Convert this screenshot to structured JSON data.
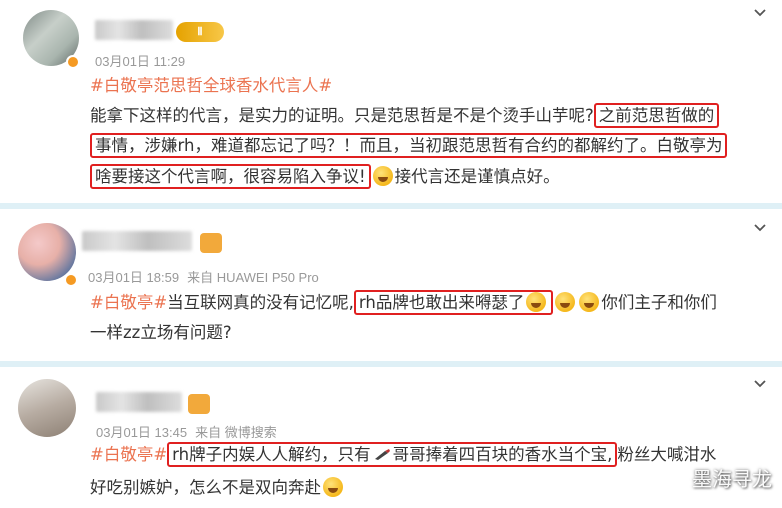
{
  "posts": [
    {
      "time": "03月01日 11:29",
      "source": "",
      "line1_pre": "能拿下这样的代言，是实力的证明。只是范思哲是不是个烫手山芋呢?",
      "line1_hl": "之前范思哲做的",
      "line2_hl": "事情，涉嫌rh，难道都忘记了吗？！而且，当初跟范思哲有合约的都解约了。白敬亭为",
      "line3_hl": "啥要接这个代言啊，很容易陷入争议!",
      "line3_post": "接代言还是谨慎点好。",
      "tag": "#白敬亭范思哲全球香水代言人#",
      "level_badge": "Ⅱ"
    },
    {
      "time": "03月01日 18:59",
      "source": "来自 HUAWEI P50 Pro",
      "tag": "#白敬亭#",
      "line1_pre": "当互联网真的没有记忆呢,",
      "line1_hl": "rh品牌也敢出来嘚瑟了",
      "line1_post": "你们主子和你们",
      "line2": "一样zz立场有问题?"
    },
    {
      "time": "03月01日 13:45",
      "source": "来自 微博搜索",
      "tag": "#白敬亭#",
      "line1_hl": "rh牌子内娱人人解约，只有",
      "line1_hl_b": "哥哥捧着四百块的香水当个宝,",
      "line1_post": "粉丝大喊泔水",
      "line2": "好吃别嫉妒，怎么不是双向奔赴"
    }
  ],
  "watermark": "墨海寻龙",
  "colors": {
    "tag": "#eb7350",
    "highlight_border": "#e02020",
    "separator": "#dff0f6",
    "meta": "#999999"
  },
  "icons": [
    "chevron-down-icon",
    "verified-badge-icon",
    "level-badge-icon",
    "emoji-icon",
    "brush-icon"
  ]
}
